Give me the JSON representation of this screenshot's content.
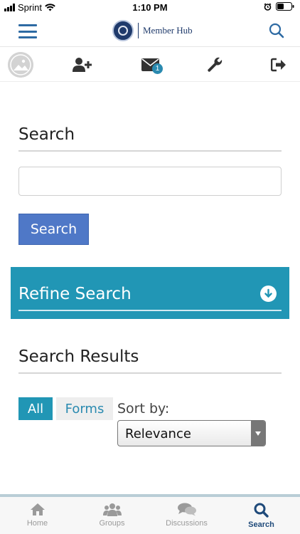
{
  "status_bar": {
    "carrier": "Sprint",
    "time": "1:10 PM"
  },
  "header": {
    "logo_text": "Member Hub",
    "accent_color": "#2d6aa3"
  },
  "toolbar": {
    "icons": [
      "avatar",
      "add-user-icon",
      "mail-icon",
      "wrench-icon",
      "logout-icon"
    ],
    "mail_badge": "1"
  },
  "search": {
    "title": "Search",
    "input_value": "",
    "button_label": "Search"
  },
  "refine": {
    "title": "Refine Search",
    "color": "#2196b5"
  },
  "results": {
    "title": "Search Results",
    "filters": [
      "All",
      "Forms"
    ],
    "active_filter": "All",
    "sort_label": "Sort by:",
    "sort_value": "Relevance"
  },
  "tabbar": {
    "tabs": [
      {
        "label": "Home",
        "icon": "home-icon"
      },
      {
        "label": "Groups",
        "icon": "groups-icon"
      },
      {
        "label": "Discussions",
        "icon": "discussions-icon"
      },
      {
        "label": "Search",
        "icon": "search-icon"
      }
    ],
    "active_tab": "Search"
  }
}
